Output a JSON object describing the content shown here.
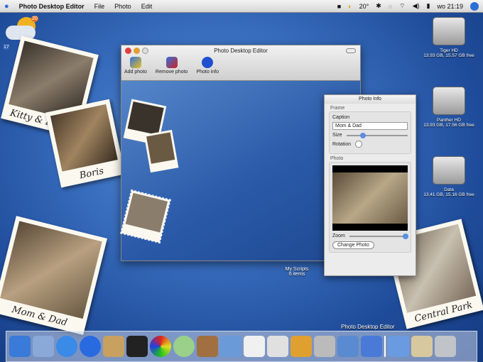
{
  "menubar": {
    "app": "Photo Desktop Editor",
    "menus": [
      "File",
      "Photo",
      "Edit"
    ],
    "temperature": "20°",
    "clock": "wo 21:19"
  },
  "weather_widget": {
    "high": "20",
    "low": "17"
  },
  "desktop_photos": [
    {
      "caption": "Kitty & Kathy"
    },
    {
      "caption": "Boris"
    },
    {
      "caption": "Mom & Dad"
    },
    {
      "caption": "Central Park"
    }
  ],
  "window": {
    "title": "Photo Desktop Editor",
    "tools": [
      {
        "label": "Add photo",
        "color": "#e8c020"
      },
      {
        "label": "Remove photo",
        "color": "#d02020"
      },
      {
        "label": "Photo info",
        "color": "#2050d0"
      }
    ]
  },
  "info_panel": {
    "title": "Photo Info",
    "frame_section": "Frame",
    "caption_label": "Caption",
    "caption_value": "Mom & Dad",
    "size_label": "Size",
    "size_value": 0.25,
    "rotation_label": "Rotation",
    "photo_section": "Photo",
    "zoom_label": "Zoom",
    "zoom_value": 0.95,
    "change_button": "Change Photo"
  },
  "drives": [
    {
      "name": "Tiger HD",
      "info": "13.93 GB, 15.57 GB free"
    },
    {
      "name": "Panther HD",
      "info": "13.93 GB, 17.56 GB free"
    },
    {
      "name": "Data",
      "info": "13.41 GB, 15.16 GB free"
    }
  ],
  "folder": {
    "name": "My Scripts",
    "info": "6 items"
  },
  "desktop_label": "Photo Desktop Editor"
}
